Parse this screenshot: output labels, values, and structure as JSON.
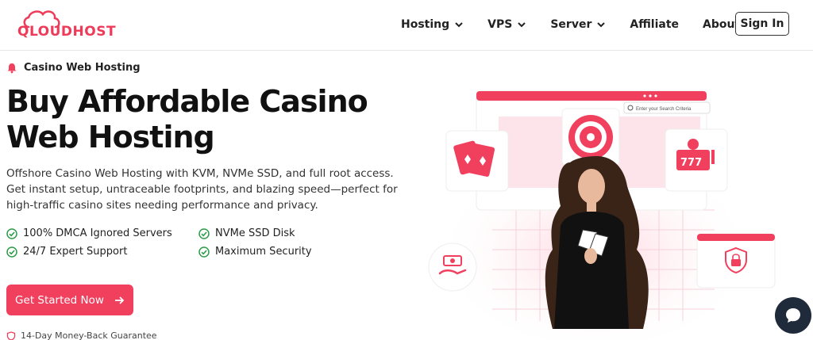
{
  "brand": {
    "logo_text": "QLOUDHOST",
    "accent_color": "#f0405e"
  },
  "nav": {
    "items": [
      {
        "label": "Hosting",
        "has_dropdown": true
      },
      {
        "label": "VPS",
        "has_dropdown": true
      },
      {
        "label": "Server",
        "has_dropdown": true
      },
      {
        "label": "Affiliate",
        "has_dropdown": false
      },
      {
        "label": "About",
        "has_dropdown": false
      }
    ],
    "signin_label": "Sign In"
  },
  "hero": {
    "eyebrow": "Casino Web Hosting",
    "headline_line1": "Buy Affordable Casino",
    "headline_line2": "Web Hosting",
    "description": "Offshore Casino Web Hosting with KVM, NVMe SSD, and full root access. Get instant setup, untraceable footprints, and blazing speed—perfect for high-traffic casino sites needing performance and privacy.",
    "features": [
      "100% DMCA Ignored Servers",
      "NVMe SSD Disk",
      "24/7 Expert Support",
      "Maximum Security"
    ],
    "cta_label": "Get Started Now",
    "guarantee": "14-Day Money-Back Guarantee"
  },
  "illustration": {
    "search_placeholder": "Enter your Search Criteria",
    "icons": [
      "playing-cards-icon",
      "roulette-icon",
      "slot-machine-icon",
      "cash-hand-icon",
      "security-lock-icon"
    ]
  },
  "chat": {
    "icon": "chat-bubble-icon"
  }
}
